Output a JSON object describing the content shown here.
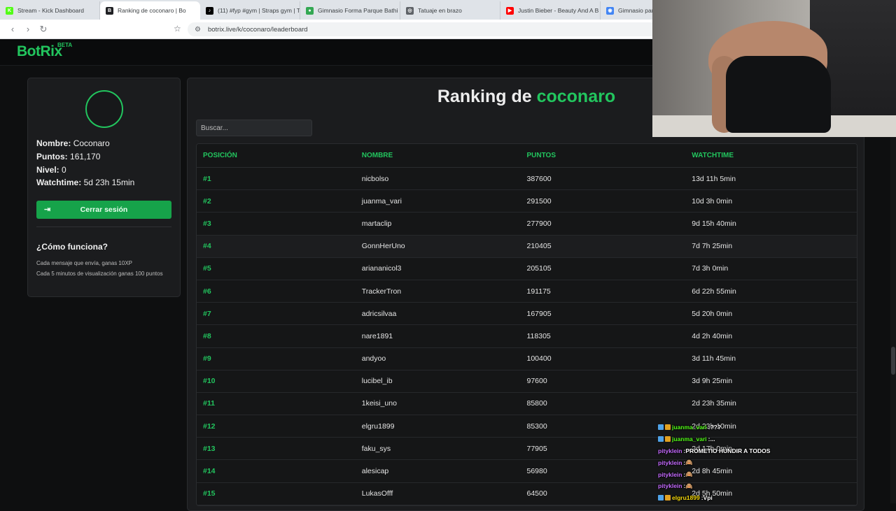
{
  "browser": {
    "tabs": [
      {
        "title": "Stream - Kick Dashboard",
        "icon": "kick-icon",
        "color": "#53fc18",
        "glyph": "K"
      },
      {
        "title": "Ranking de coconaro | Bo",
        "icon": "botrix-icon",
        "color": "#202124",
        "glyph": "B"
      },
      {
        "title": "(11) #fyp #gym | Straps gym | T",
        "icon": "tiktok-icon",
        "color": "#000000",
        "glyph": "♪"
      },
      {
        "title": "Gimnasio Forma Parque Bathi",
        "icon": "maps-pin-icon",
        "color": "#34a853",
        "glyph": "●"
      },
      {
        "title": "Tatuaje en brazo",
        "icon": "google-icon",
        "color": "#5f6368",
        "glyph": "◎"
      },
      {
        "title": "Justin Bieber - Beauty And A B",
        "icon": "youtube-icon",
        "color": "#ff0000",
        "glyph": "▶"
      },
      {
        "title": "Gimnasio parq",
        "icon": "globe-icon",
        "color": "#4285f4",
        "glyph": "◉"
      }
    ],
    "url": "botrix.live/k/coconaro/leaderboard"
  },
  "site": {
    "logo": "BotRix",
    "beta": "BETA"
  },
  "profile": {
    "name_label": "Nombre:",
    "name_value": "Coconaro",
    "points_label": "Puntos:",
    "points_value": "161,170",
    "level_label": "Nivel:",
    "level_value": "0",
    "watch_label": "Watchtime:",
    "watch_value": "5d 23h 15min",
    "logout_label": "Cerrar sesión",
    "how_title": "¿Cómo funciona?",
    "how_line1": "Cada mensaje que envía, ganas 10XP",
    "how_line2": "Cada 5 minutos de visualización ganas 100 puntos"
  },
  "leaderboard": {
    "title_prefix": "Ranking de",
    "title_channel": "coconaro",
    "search_placeholder": "Buscar...",
    "columns": [
      "POSICIÓN",
      "NOMBRE",
      "PUNTOS",
      "WATCHTIME"
    ],
    "rows": [
      {
        "pos": "#1",
        "name": "nicbolso",
        "points": "387600",
        "watch": "13d 11h 5min"
      },
      {
        "pos": "#2",
        "name": "juanma_vari",
        "points": "291500",
        "watch": "10d 3h 0min"
      },
      {
        "pos": "#3",
        "name": "martaclip",
        "points": "277900",
        "watch": "9d 15h 40min"
      },
      {
        "pos": "#4",
        "name": "GonnHerUno",
        "points": "210405",
        "watch": "7d 7h 25min"
      },
      {
        "pos": "#5",
        "name": "ariananicol3",
        "points": "205105",
        "watch": "7d 3h 0min"
      },
      {
        "pos": "#6",
        "name": "TrackerTron",
        "points": "191175",
        "watch": "6d 22h 55min"
      },
      {
        "pos": "#7",
        "name": "adricsilvaa",
        "points": "167905",
        "watch": "5d 20h 0min"
      },
      {
        "pos": "#8",
        "name": "nare1891",
        "points": "118305",
        "watch": "4d 2h 40min"
      },
      {
        "pos": "#9",
        "name": "andyoo",
        "points": "100400",
        "watch": "3d 11h 45min"
      },
      {
        "pos": "#10",
        "name": "lucibel_ib",
        "points": "97600",
        "watch": "3d 9h 25min"
      },
      {
        "pos": "#11",
        "name": "1keisi_uno",
        "points": "85800",
        "watch": "2d 23h 35min"
      },
      {
        "pos": "#12",
        "name": "elgru1899",
        "points": "85300",
        "watch": "2d 23h 10min"
      },
      {
        "pos": "#13",
        "name": "faku_sys",
        "points": "77905",
        "watch": "2d 17h 0min"
      },
      {
        "pos": "#14",
        "name": "alesicap",
        "points": "56980",
        "watch": "2d 8h 45min"
      },
      {
        "pos": "#15",
        "name": "LukasOfff",
        "points": "64500",
        "watch": "2d 5h 50min"
      }
    ]
  },
  "chat": [
    {
      "user": "juanma_vari",
      "text": "???",
      "badges": true,
      "user_color": "#53fc18"
    },
    {
      "user": "juanma_vari",
      "text": "...",
      "badges": true,
      "user_color": "#53fc18"
    },
    {
      "user": "pityklein",
      "text": "PROMETIO HUNDIR A TODOS",
      "badges": false,
      "user_color": "#c56bff"
    },
    {
      "user": "pityklein",
      "text": "🙈",
      "badges": false,
      "user_color": "#c56bff"
    },
    {
      "user": "pityklein",
      "text": "🙈",
      "badges": false,
      "user_color": "#c56bff"
    },
    {
      "user": "pityklein",
      "text": "🙈",
      "badges": false,
      "user_color": "#c56bff"
    },
    {
      "user": "elgru1899",
      "text": "Vpi",
      "badges": true,
      "user_color": "#f5d90a"
    }
  ]
}
